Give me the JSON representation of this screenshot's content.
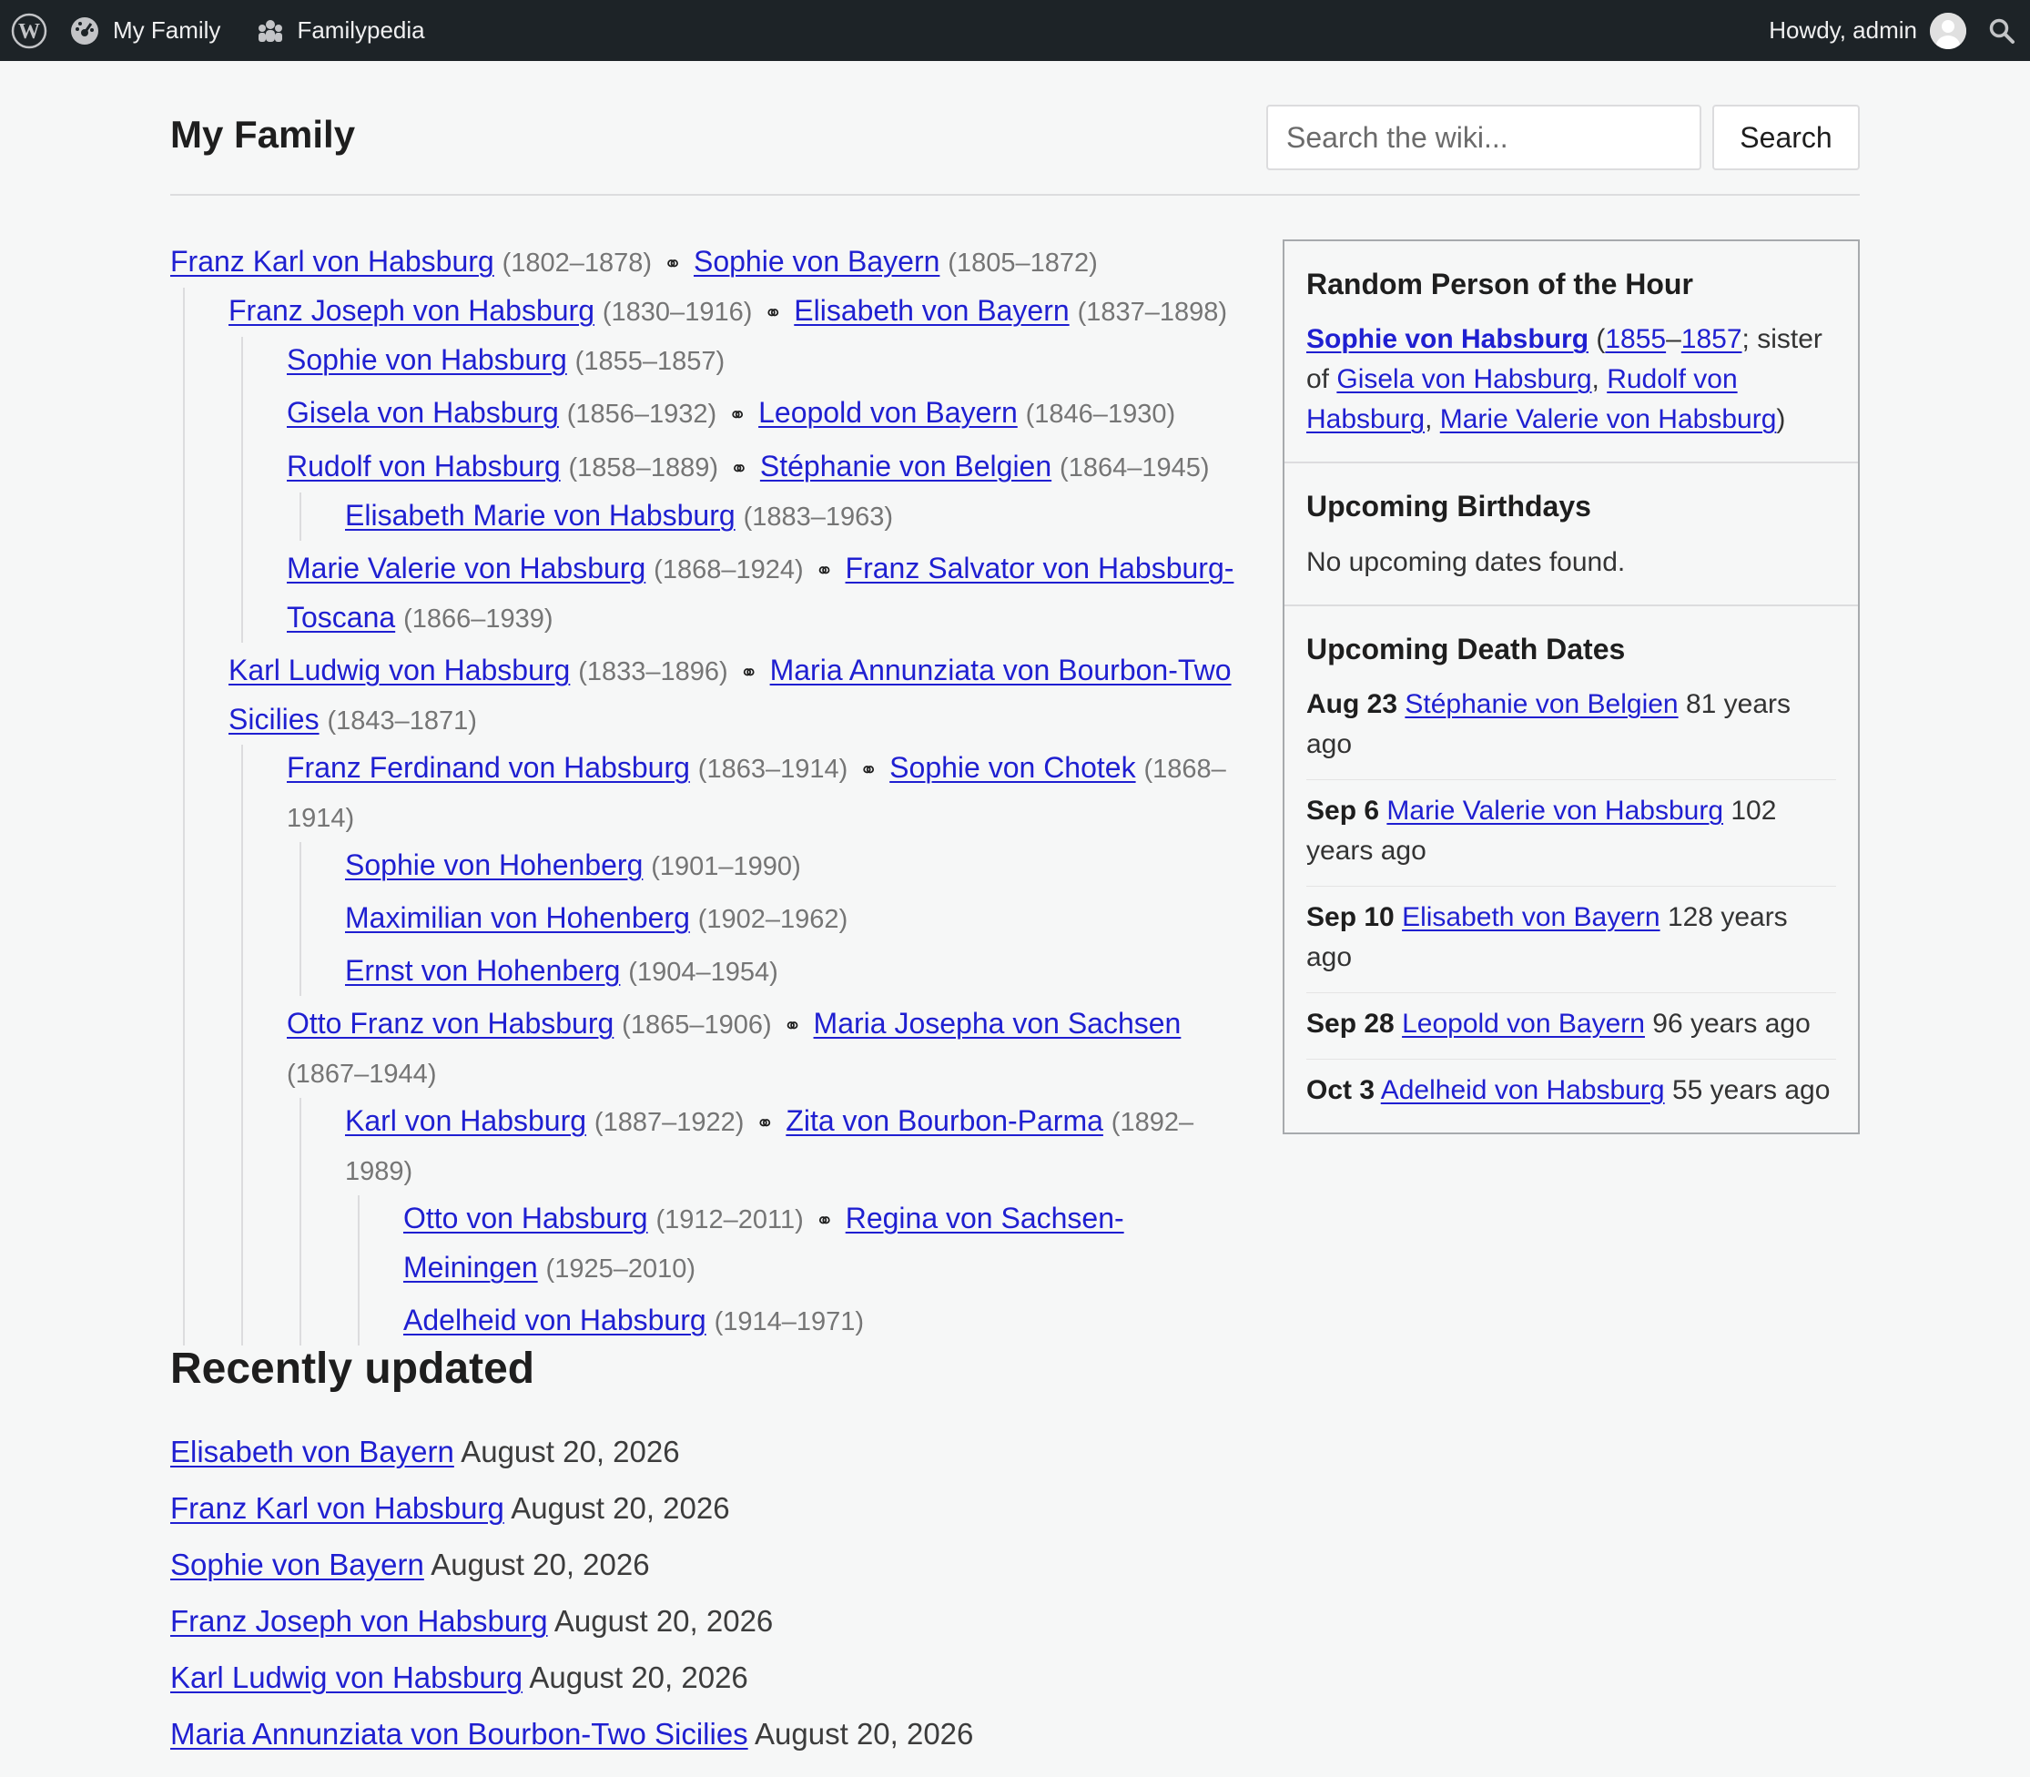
{
  "admin_bar": {
    "site_name": "My Family",
    "plugin_name": "Familypedia",
    "greeting": "Howdy, admin"
  },
  "header": {
    "title": "My Family",
    "search_placeholder": "Search the wiki...",
    "search_button": "Search"
  },
  "tree": {
    "n1": {
      "name": "Franz Karl von Habsburg",
      "dates": "(1802–1878)",
      "spouse": "Sophie von Bayern",
      "spouse_dates": "(1805–1872)"
    },
    "n2": {
      "name": "Franz Joseph von Habsburg",
      "dates": "(1830–1916)",
      "spouse": "Elisabeth von Bayern",
      "spouse_dates": "(1837–1898)"
    },
    "n3": {
      "name": "Sophie von Habsburg",
      "dates": "(1855–1857)"
    },
    "n4": {
      "name": "Gisela von Habsburg",
      "dates": "(1856–1932)",
      "spouse": "Leopold von Bayern",
      "spouse_dates": "(1846–1930)"
    },
    "n5": {
      "name": "Rudolf von Habsburg",
      "dates": "(1858–1889)",
      "spouse": "Stéphanie von Belgien",
      "spouse_dates": "(1864–1945)"
    },
    "n6": {
      "name": "Elisabeth Marie von Habsburg",
      "dates": "(1883–1963)"
    },
    "n7": {
      "name": "Marie Valerie von Habsburg",
      "dates": "(1868–1924)",
      "spouse": "Franz Salvator von Habsburg-Toscana",
      "spouse_dates": "(1866–1939)"
    },
    "n8": {
      "name": "Karl Ludwig von Habsburg",
      "dates": "(1833–1896)",
      "spouse": "Maria Annunziata von Bourbon-Two Sicilies",
      "spouse_dates": "(1843–1871)"
    },
    "n9": {
      "name": "Franz Ferdinand von Habsburg",
      "dates": "(1863–1914)",
      "spouse": "Sophie von Chotek",
      "spouse_dates": "(1868–1914)"
    },
    "n10": {
      "name": "Sophie von Hohenberg",
      "dates": "(1901–1990)"
    },
    "n11": {
      "name": "Maximilian von Hohenberg",
      "dates": "(1902–1962)"
    },
    "n12": {
      "name": "Ernst von Hohenberg",
      "dates": "(1904–1954)"
    },
    "n13": {
      "name": "Otto Franz von Habsburg",
      "dates": "(1865–1906)",
      "spouse": "Maria Josepha von Sachsen",
      "spouse_dates": "(1867–1944)"
    },
    "n14": {
      "name": "Karl von Habsburg",
      "dates": "(1887–1922)",
      "spouse": "Zita von Bourbon-Parma",
      "spouse_dates": "(1892–1989)"
    },
    "n15": {
      "name": "Otto von Habsburg",
      "dates": "(1912–2011)",
      "spouse": "Regina von Sachsen-Meiningen",
      "spouse_dates": "(1925–2010)"
    },
    "n16": {
      "name": "Adelheid von Habsburg",
      "dates": "(1914–1971)"
    }
  },
  "recent": {
    "heading": "Recently updated",
    "items": [
      {
        "name": "Elisabeth von Bayern",
        "date": "August 20, 2026"
      },
      {
        "name": "Franz Karl von Habsburg",
        "date": "August 20, 2026"
      },
      {
        "name": "Sophie von Bayern",
        "date": "August 20, 2026"
      },
      {
        "name": "Franz Joseph von Habsburg",
        "date": "August 20, 2026"
      },
      {
        "name": "Karl Ludwig von Habsburg",
        "date": "August 20, 2026"
      },
      {
        "name": "Maria Annunziata von Bourbon-Two Sicilies",
        "date": "August 20, 2026"
      }
    ]
  },
  "sidebar": {
    "random": {
      "heading": "Random Person of the Hour",
      "name": "Sophie von Habsburg",
      "birth_year": "1855",
      "death_year": "1857",
      "sister_prefix": "sister of",
      "siblings": [
        "Gisela von Habsburg",
        "Rudolf von Habsburg",
        "Marie Valerie von Habsburg"
      ]
    },
    "birthdays": {
      "heading": "Upcoming Birthdays",
      "empty": "No upcoming dates found."
    },
    "deaths": {
      "heading": "Upcoming Death Dates",
      "items": [
        {
          "date": "Aug 23",
          "name": "Stéphanie von Belgien",
          "ago": "81 years ago"
        },
        {
          "date": "Sep 6",
          "name": "Marie Valerie von Habsburg",
          "ago": "102 years ago"
        },
        {
          "date": "Sep 10",
          "name": "Elisabeth von Bayern",
          "ago": "128 years ago"
        },
        {
          "date": "Sep 28",
          "name": "Leopold von Bayern",
          "ago": "96 years ago"
        },
        {
          "date": "Oct 3",
          "name": "Adelheid von Habsburg",
          "ago": "55 years ago"
        }
      ]
    }
  }
}
